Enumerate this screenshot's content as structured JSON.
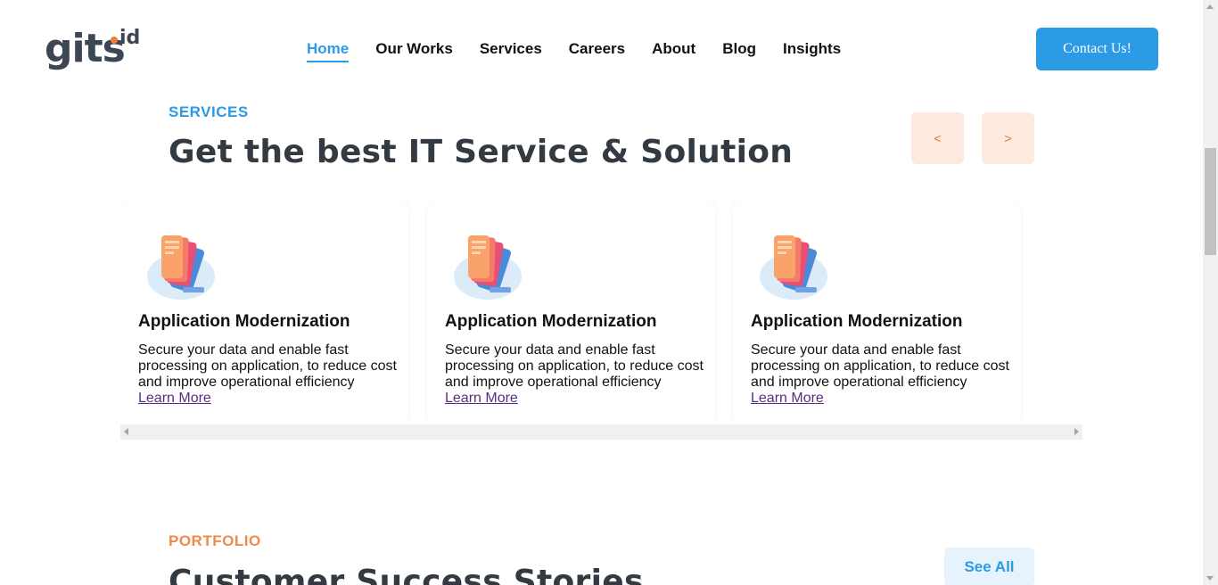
{
  "logo": {
    "text": "gits",
    "suffix": "id"
  },
  "nav": {
    "items": [
      {
        "label": "Home",
        "active": true
      },
      {
        "label": "Our Works"
      },
      {
        "label": "Services"
      },
      {
        "label": "Careers"
      },
      {
        "label": "About"
      },
      {
        "label": "Blog"
      },
      {
        "label": "Insights"
      }
    ],
    "contact_label": "Contact Us!"
  },
  "services": {
    "eyebrow": "SERVICES",
    "title": "Get the best IT Service & Solution",
    "prev_label": "<",
    "next_label": ">",
    "cards": [
      {
        "icon": "mobile-devices-icon",
        "title": "Application Modernization",
        "description": "Secure your data and enable fast processing on application, to reduce cost and improve operational efficiency",
        "link": "Learn More"
      },
      {
        "icon": "mobile-devices-icon",
        "title": "Application Modernization",
        "description": "Secure your data and enable fast processing on application, to reduce cost and improve operational efficiency",
        "link": "Learn More"
      },
      {
        "icon": "mobile-devices-icon",
        "title": "Application Modernization",
        "description": "Secure your data and enable fast processing on application, to reduce cost and improve operational efficiency",
        "link": "Learn More"
      }
    ]
  },
  "portfolio": {
    "eyebrow": "PORTFOLIO",
    "title": "Customer Success Stories",
    "see_all_label": "See All"
  },
  "colors": {
    "accent": "#2b9be6",
    "orange": "#f08a4b",
    "arrow_bg": "#fde9df",
    "title": "#333a42"
  }
}
